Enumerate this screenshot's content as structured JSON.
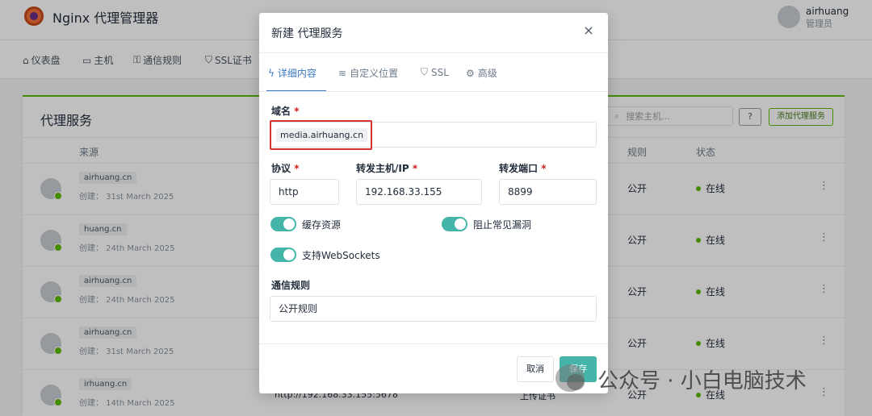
{
  "app": {
    "title": "Nginx 代理管理器"
  },
  "user": {
    "name": "airhuang",
    "role": "管理员"
  },
  "nav": [
    {
      "icon": "home-icon",
      "glyph": "⌂",
      "label": "仪表盘"
    },
    {
      "icon": "monitor-icon",
      "glyph": "▭",
      "label": "主机"
    },
    {
      "icon": "lock-icon",
      "glyph": "⚿",
      "label": "通信规则"
    },
    {
      "icon": "shield-icon",
      "glyph": "⛉",
      "label": "SSL证书"
    }
  ],
  "card": {
    "title": "代理服务",
    "search_placeholder": "搜索主机...",
    "help_label": "?",
    "add_label": "添加代理服务",
    "columns": {
      "source": "来源",
      "access": "规则",
      "status": "状态"
    }
  },
  "rows": [
    {
      "domain": "     airhuang.cn",
      "created": "创建：  31st March 2025",
      "target": "",
      "ssl": "",
      "access": "公开",
      "status": "在线"
    },
    {
      "domain": "          huang.cn",
      "created": "创建：  24th March 2025",
      "target": "",
      "ssl": "",
      "access": "公开",
      "status": "在线"
    },
    {
      "domain": "     airhuang.cn",
      "created": "创建：  24th March 2025",
      "target": "",
      "ssl": "",
      "access": "公开",
      "status": "在线"
    },
    {
      "domain": "       airhuang.cn",
      "created": "创建：  31st March 2025",
      "target": "",
      "ssl": "",
      "access": "公开",
      "status": "在线"
    },
    {
      "domain": "         irhuang.cn",
      "created": "创建：  14th March 2025",
      "target": "http://192.168.33.155:5678",
      "ssl": "上传证书",
      "access": "公开",
      "status": "在线"
    }
  ],
  "modal": {
    "title": "新建 代理服务",
    "close_glyph": "×",
    "tabs": [
      {
        "icon": "bolt-icon",
        "glyph": "ϟ",
        "label": "详细内容"
      },
      {
        "icon": "layers-icon",
        "glyph": "≋",
        "label": "自定义位置"
      },
      {
        "icon": "shield-icon",
        "glyph": "⛉",
        "label": "SSL"
      },
      {
        "icon": "gear-icon",
        "glyph": "⚙",
        "label": "高级"
      }
    ],
    "domain_label": "域名",
    "domain_chip": "media.airhuang.cn",
    "scheme_label": "协议",
    "scheme_value": "http",
    "host_label": "转发主机/IP",
    "host_value": "192.168.33.155",
    "port_label": "转发端口",
    "port_value": "8899",
    "required_mark": "*",
    "toggles": {
      "cache": "缓存资源",
      "block_exploits": "阻止常见漏洞",
      "websockets": "支持WebSockets"
    },
    "access_label": "通信规则",
    "access_value": "公开规则",
    "cancel_label": "取消",
    "save_label": "保存"
  },
  "watermark": "公众号 · 小白电脑技术",
  "colors": {
    "accent_green": "#5eba00",
    "teal": "#45b5aa",
    "tab_blue": "#3b78c4",
    "highlight_red": "#d8322d"
  }
}
